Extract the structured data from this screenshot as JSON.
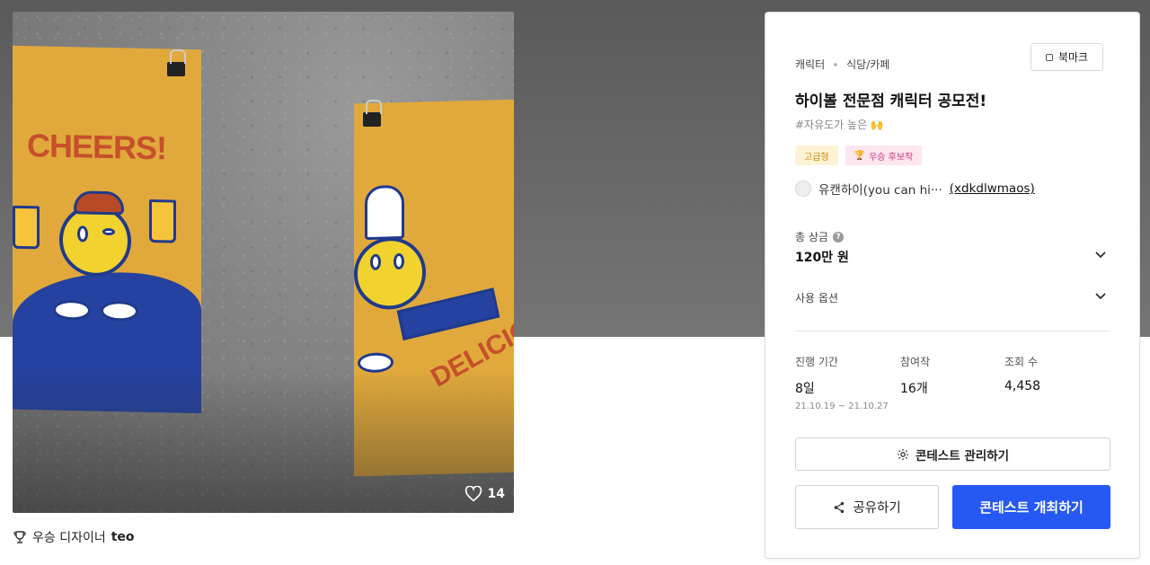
{
  "artwork": {
    "poster_left_text": "CHEERS!",
    "poster_right_text": "DELICIOU",
    "like_count": "14",
    "heart_icon": "heart-outline-icon"
  },
  "winner": {
    "prefix": "우승 디자이너",
    "name": "teo",
    "icon": "trophy-icon"
  },
  "contest": {
    "category_1": "캐릭터",
    "category_2": "식당/카페",
    "bookmark_label": "북마크",
    "title": "하이볼 전문점 캐릭터 공모전!",
    "tagline": "#자유도가 높은 🙌",
    "badges": [
      "고급형",
      "우승 후보작"
    ],
    "author_name": "유캔하이(you can hi···",
    "author_id": "(xdkdlwmaos)",
    "prize_label": "총 상금",
    "prize_value": "120만 원",
    "usage_label": "사용 옵션",
    "stats": {
      "period_label": "진행 기간",
      "period_value": "8일",
      "period_range": "21.10.19 ~ 21.10.27",
      "entries_label": "참여작",
      "entries_value": "16개",
      "views_label": "조회 수",
      "views_value": "4,458"
    },
    "manage_label": "콘테스트 관리하기",
    "share_label": "공유하기",
    "host_label": "콘테스트 개최하기"
  },
  "colors": {
    "primary": "#2659f3",
    "poster_yellow": "#e1a93c",
    "poster_blue": "#2642a0",
    "poster_red": "#c5502b"
  }
}
